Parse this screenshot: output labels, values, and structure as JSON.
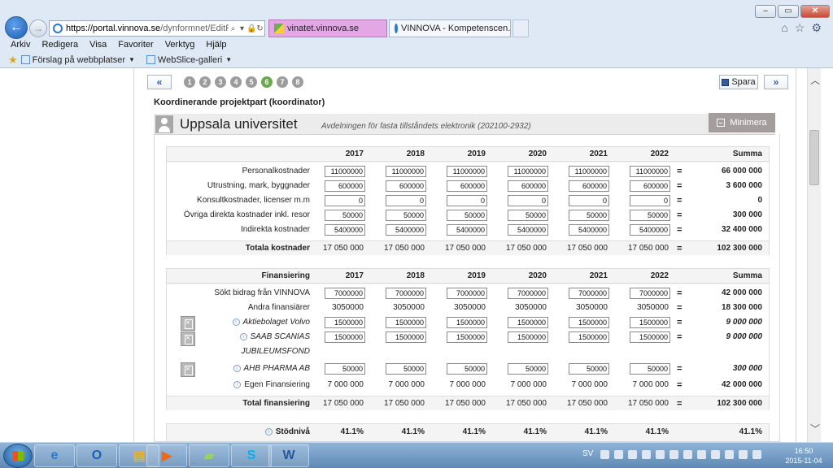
{
  "browser": {
    "url_host": "https://portal.vinnova.se",
    "url_path": "/dynformnet/EditForm.a",
    "tabs": [
      {
        "label": "vinatet.vinnova.se"
      },
      {
        "label": "VINNOVA - Kompetenscen...",
        "close": "×"
      }
    ],
    "menu": [
      "Arkiv",
      "Redigera",
      "Visa",
      "Favoriter",
      "Verktyg",
      "Hjälp"
    ],
    "favorites": [
      {
        "label": "Förslag på webbplatser"
      },
      {
        "label": "WebSlice-galleri"
      }
    ]
  },
  "wizard": {
    "prev_label": "«",
    "next_label": "»",
    "steps": [
      "1",
      "2",
      "3",
      "4",
      "5",
      "6",
      "7",
      "8"
    ],
    "active_step": "6",
    "save_label": "Spara"
  },
  "section_title": "Koordinerande projektpart (koordinator)",
  "org": {
    "name": "Uppsala universitet",
    "dept": "Avdelningen för fasta tillståndets elektronik (202100-2932)",
    "minimize_label": "Minimera"
  },
  "costs": {
    "header_label": "",
    "years": [
      "2017",
      "2018",
      "2019",
      "2020",
      "2021",
      "2022"
    ],
    "sum_header": "Summa",
    "rows": [
      {
        "label": "Personalkostnader",
        "values": [
          "11000000",
          "11000000",
          "11000000",
          "11000000",
          "11000000",
          "11000000"
        ],
        "eq": "=",
        "sum": "66 000 000"
      },
      {
        "label": "Utrustning, mark, byggnader",
        "values": [
          "600000",
          "600000",
          "600000",
          "600000",
          "600000",
          "600000"
        ],
        "eq": "=",
        "sum": "3 600 000"
      },
      {
        "label": "Konsultkostnader, licenser m.m",
        "values": [
          "0",
          "0",
          "0",
          "0",
          "0",
          "0"
        ],
        "eq": "=",
        "sum": "0"
      },
      {
        "label": "Övriga direkta kostnader inkl. resor",
        "values": [
          "50000",
          "50000",
          "50000",
          "50000",
          "50000",
          "50000"
        ],
        "eq": "=",
        "sum": "300 000"
      },
      {
        "label": "Indirekta kostnader",
        "values": [
          "5400000",
          "5400000",
          "5400000",
          "5400000",
          "5400000",
          "5400000"
        ],
        "eq": "=",
        "sum": "32 400 000"
      }
    ],
    "total": {
      "label": "Totala kostnader",
      "values": [
        "17 050 000",
        "17 050 000",
        "17 050 000",
        "17 050 000",
        "17 050 000",
        "17 050 000"
      ],
      "eq": "=",
      "sum": "102 300 000"
    }
  },
  "financing": {
    "header_label": "Finansiering",
    "years": [
      "2017",
      "2018",
      "2019",
      "2020",
      "2021",
      "2022"
    ],
    "sum_header": "Summa",
    "rows": [
      {
        "label": "Sökt bidrag från VINNOVA",
        "input": true,
        "values": [
          "7000000",
          "7000000",
          "7000000",
          "7000000",
          "7000000",
          "7000000"
        ],
        "eq": "=",
        "sum": "42 000 000"
      },
      {
        "label": "Andra finansiärer",
        "input": false,
        "values": [
          "3050000",
          "3050000",
          "3050000",
          "3050000",
          "3050000",
          "3050000"
        ],
        "eq": "=",
        "sum": "18 300 000"
      },
      {
        "label": "Aktiebolaget Volvo",
        "input": true,
        "italic": true,
        "info": true,
        "delete": true,
        "values": [
          "1500000",
          "1500000",
          "1500000",
          "1500000",
          "1500000",
          "1500000"
        ],
        "eq": "=",
        "sum": "9 000 000"
      },
      {
        "label": "SAAB SCANIAS",
        "label2": "JUBILEUMSFOND",
        "input": true,
        "italic": true,
        "info": true,
        "delete": true,
        "values": [
          "1500000",
          "1500000",
          "1500000",
          "1500000",
          "1500000",
          "1500000"
        ],
        "eq": "=",
        "sum": "9 000 000"
      },
      {
        "label": "AHB PHARMA AB",
        "input": true,
        "italic": true,
        "info": true,
        "delete": true,
        "values": [
          "50000",
          "50000",
          "50000",
          "50000",
          "50000",
          "50000"
        ],
        "eq": "=",
        "sum": "300 000"
      },
      {
        "label": "Egen Finansiering",
        "input": false,
        "info": true,
        "values": [
          "7 000 000",
          "7 000 000",
          "7 000 000",
          "7 000 000",
          "7 000 000",
          "7 000 000"
        ],
        "eq": "=",
        "sum": "42 000 000"
      }
    ],
    "total": {
      "label": "Total finansiering",
      "values": [
        "17 050 000",
        "17 050 000",
        "17 050 000",
        "17 050 000",
        "17 050 000",
        "17 050 000"
      ],
      "eq": "=",
      "sum": "102 300 000"
    }
  },
  "support": {
    "label": "Stödnivå",
    "values": [
      "41.1%",
      "41.1%",
      "41.1%",
      "41.1%",
      "41.1%",
      "41.1%"
    ],
    "sum": "41.1%"
  },
  "taskbar": {
    "lang": "SV",
    "time": "16:50",
    "date": "2015-11-04"
  }
}
